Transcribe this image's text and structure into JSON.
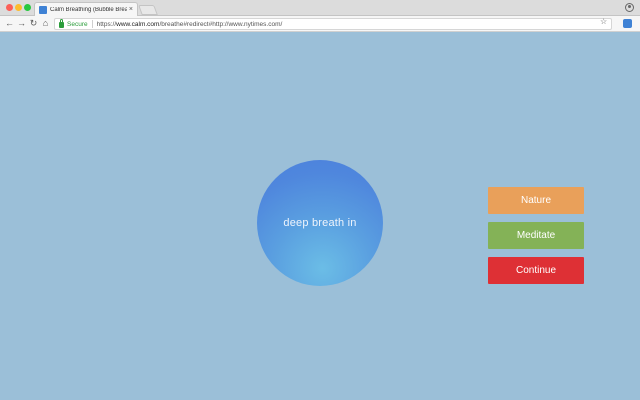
{
  "browser": {
    "tab_title": "Calm Breathing (Bubble Breat",
    "tab_close": "×",
    "secure_label": "Secure",
    "url_scheme": "https://",
    "url_host": "www.calm.com",
    "url_path": "/breathe#redirect#http://www.nytimes.com/",
    "nav": {
      "back": "←",
      "forward": "→",
      "reload": "↻",
      "home": "⌂"
    },
    "bookmark_star": "☆",
    "icons": [
      "lock-icon",
      "star-icon",
      "profile-icon",
      "extension-icon"
    ]
  },
  "bubble": {
    "text": "deep breath in"
  },
  "buttons": {
    "nature": "Nature",
    "meditate": "Meditate",
    "continue": "Continue"
  },
  "colors": {
    "background": "#9bbfd8",
    "bubble": "#5a9fe0",
    "nature": "#e9a05a",
    "meditate": "#84b257",
    "continue": "#de3035"
  }
}
